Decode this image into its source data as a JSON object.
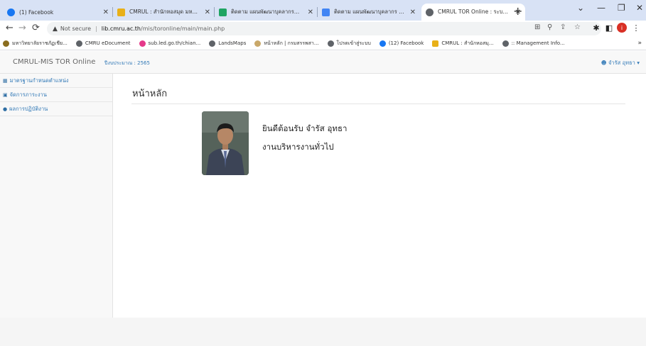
{
  "browser": {
    "tabs": [
      {
        "title": "(1) Facebook",
        "favicon": "facebook-icon",
        "color": "#1877f2",
        "active": false
      },
      {
        "title": "CMRUL : สำนักหอสมุด มหาวิทยาลัย",
        "favicon": "library-icon",
        "color": "#e8b019",
        "active": false
      },
      {
        "title": "ติดตาม แผนพัฒนาบุคลากรสำนัก",
        "favicon": "drive-icon",
        "color": "#1fa463",
        "active": false
      },
      {
        "title": "ติดตาม แผนพัฒนาบุคลากร ระบบ",
        "favicon": "forms-icon",
        "color": "#4285f4",
        "active": false
      },
      {
        "title": "CMRUL TOR Online : ระบบภาระ",
        "favicon": "globe-icon",
        "color": "#5f6368",
        "active": true
      }
    ],
    "address": {
      "security": "Not secure",
      "host": "lib.cmru.ac.th",
      "path": "/mis/toronline/main/main.php"
    },
    "bookmarks": [
      {
        "label": "มหาวิทยาลัยราชภัฏเชีย...",
        "color": "#8a6d1e"
      },
      {
        "label": "CMRU eDocument",
        "color": "#5f6368"
      },
      {
        "label": "sub.led.go.th/chian...",
        "color": "#e5398a"
      },
      {
        "label": "LandsMaps",
        "color": "#5f6368"
      },
      {
        "label": "หน้าหลัก | กรมสรรพสา...",
        "color": "#c9a86a"
      },
      {
        "label": "โปรดเข้าสู่ระบบ",
        "color": "#5f6368"
      },
      {
        "label": "(12) Facebook",
        "color": "#1877f2"
      },
      {
        "label": "CMRUL : สำนักหอสมุ...",
        "color": "#e8b019"
      },
      {
        "label": ":: Management Info...",
        "color": "#5f6368"
      }
    ],
    "bookmarks_more": "»"
  },
  "app": {
    "brand": "CMRUL-MIS TOR Online",
    "budget_year": "ปีงบประมาณ : 2565",
    "user": "จำรัส อุทธา",
    "sidebar": [
      {
        "label": "มาตรฐานกำหนดตำแหน่ง",
        "icon": "table-icon"
      },
      {
        "label": "จัดการภาระงาน",
        "icon": "calendar-icon"
      },
      {
        "label": "ผลการปฏิบัติงาน",
        "icon": "globe-icon"
      }
    ],
    "page_title": "หน้าหลัก",
    "welcome": "ยินดีต้อนรับ จำรัส อุทธา",
    "department": "งานบริหารงานทั่วไป"
  }
}
